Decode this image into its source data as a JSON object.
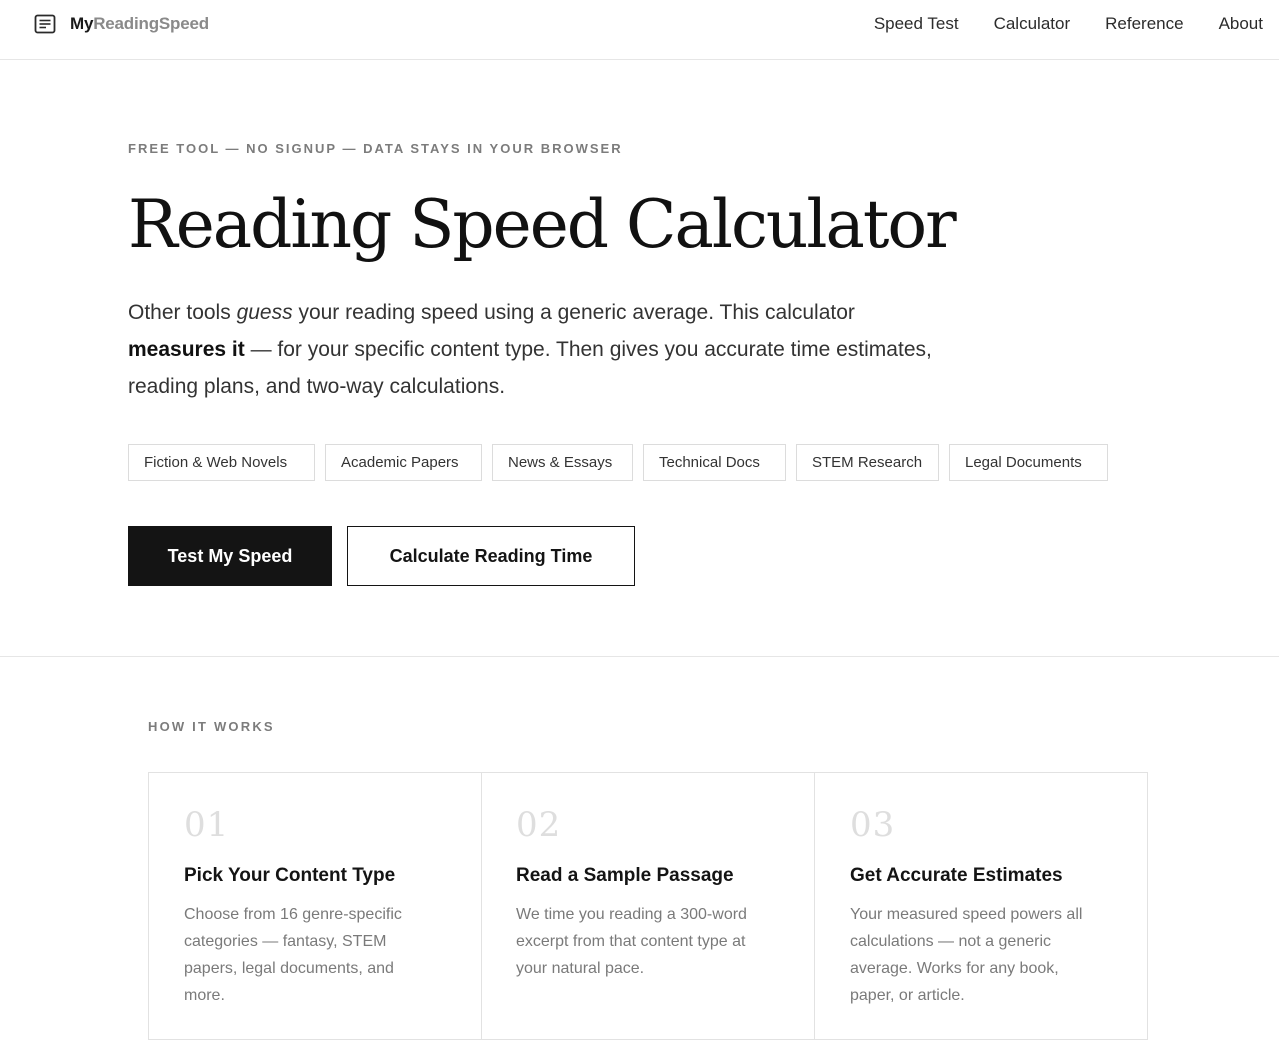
{
  "header": {
    "brand_a": "My",
    "brand_b": "ReadingSpeed",
    "nav": [
      "Speed Test",
      "Calculator",
      "Reference",
      "About"
    ]
  },
  "hero": {
    "eyebrow": "FREE TOOL — NO SIGNUP — DATA STAYS IN YOUR BROWSER",
    "title": "Reading Speed Calculator",
    "lede_1": "Other tools ",
    "lede_em": "guess",
    "lede_2": " your reading speed using a generic average. This calculator ",
    "lede_strong": "measures it",
    "lede_3": " — for your specific content type. Then gives you accurate time estimates, reading plans, and two-way calculations.",
    "tags": [
      "Fiction & Web Novels",
      "Academic Papers",
      "News & Essays",
      "Technical Docs",
      "STEM Research",
      "Legal Documents"
    ],
    "primary_button": "Test My Speed",
    "secondary_button": "Calculate Reading Time"
  },
  "how": {
    "label": "HOW IT WORKS",
    "steps": [
      {
        "num": "01",
        "title": "Pick Your Content Type",
        "body": "Choose from 16 genre-specific categories — fantasy, STEM papers, legal documents, and more."
      },
      {
        "num": "02",
        "title": "Read a Sample Passage",
        "body": "We time you reading a 300-word excerpt from that content type at your natural pace."
      },
      {
        "num": "03",
        "title": "Get Accurate Estimates",
        "body": "Your measured speed powers all calculations — not a generic average. Works for any book, paper, or article."
      }
    ]
  }
}
